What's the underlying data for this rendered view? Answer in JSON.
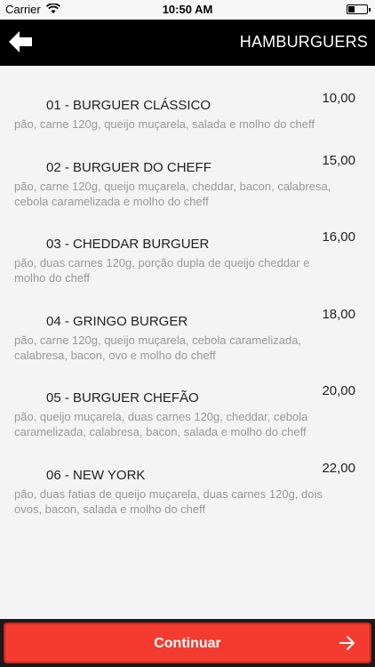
{
  "status_bar": {
    "carrier": "Carrier",
    "time": "10:50 AM"
  },
  "nav": {
    "title": "HAMBURGUERS",
    "back_icon": "arrow-left-icon"
  },
  "items": [
    {
      "name": "01 - BURGUER CLÁSSICO",
      "price": "10,00",
      "description": "pão, carne 120g, queijo muçarela, salada e molho do cheff"
    },
    {
      "name": "02 - BURGUER DO CHEFF",
      "price": "15,00",
      "description": "pão, carne 120g, queijo muçarela, cheddar, bacon, calabresa, cebola caramelizada e molho do cheff"
    },
    {
      "name": "03 - CHEDDAR BURGUER",
      "price": "16,00",
      "description": "pão, duas carnes 120g, porção dupla de queijo cheddar e molho do cheff"
    },
    {
      "name": "04 - GRINGO BURGER",
      "price": "18,00",
      "description": "pão, carne 120g, queijo muçarela, cebola caramelizada, calabresa, bacon, ovo e molho do cheff"
    },
    {
      "name": "05 - BURGUER CHEFÃO",
      "price": "20,00",
      "description": "pão, queijo muçarela, duas carnes 120g, cheddar, cebola caramelizada, calabresa, bacon, salada e molho do cheff"
    },
    {
      "name": "06 - NEW YORK",
      "price": "22,00",
      "description": "pão, duas fatias de queijo muçarela, duas carnes 120g, dois ovos, bacon, salada e molho do cheff"
    }
  ],
  "footer": {
    "continue_label": "Continuar",
    "accent": "#f33b30"
  }
}
